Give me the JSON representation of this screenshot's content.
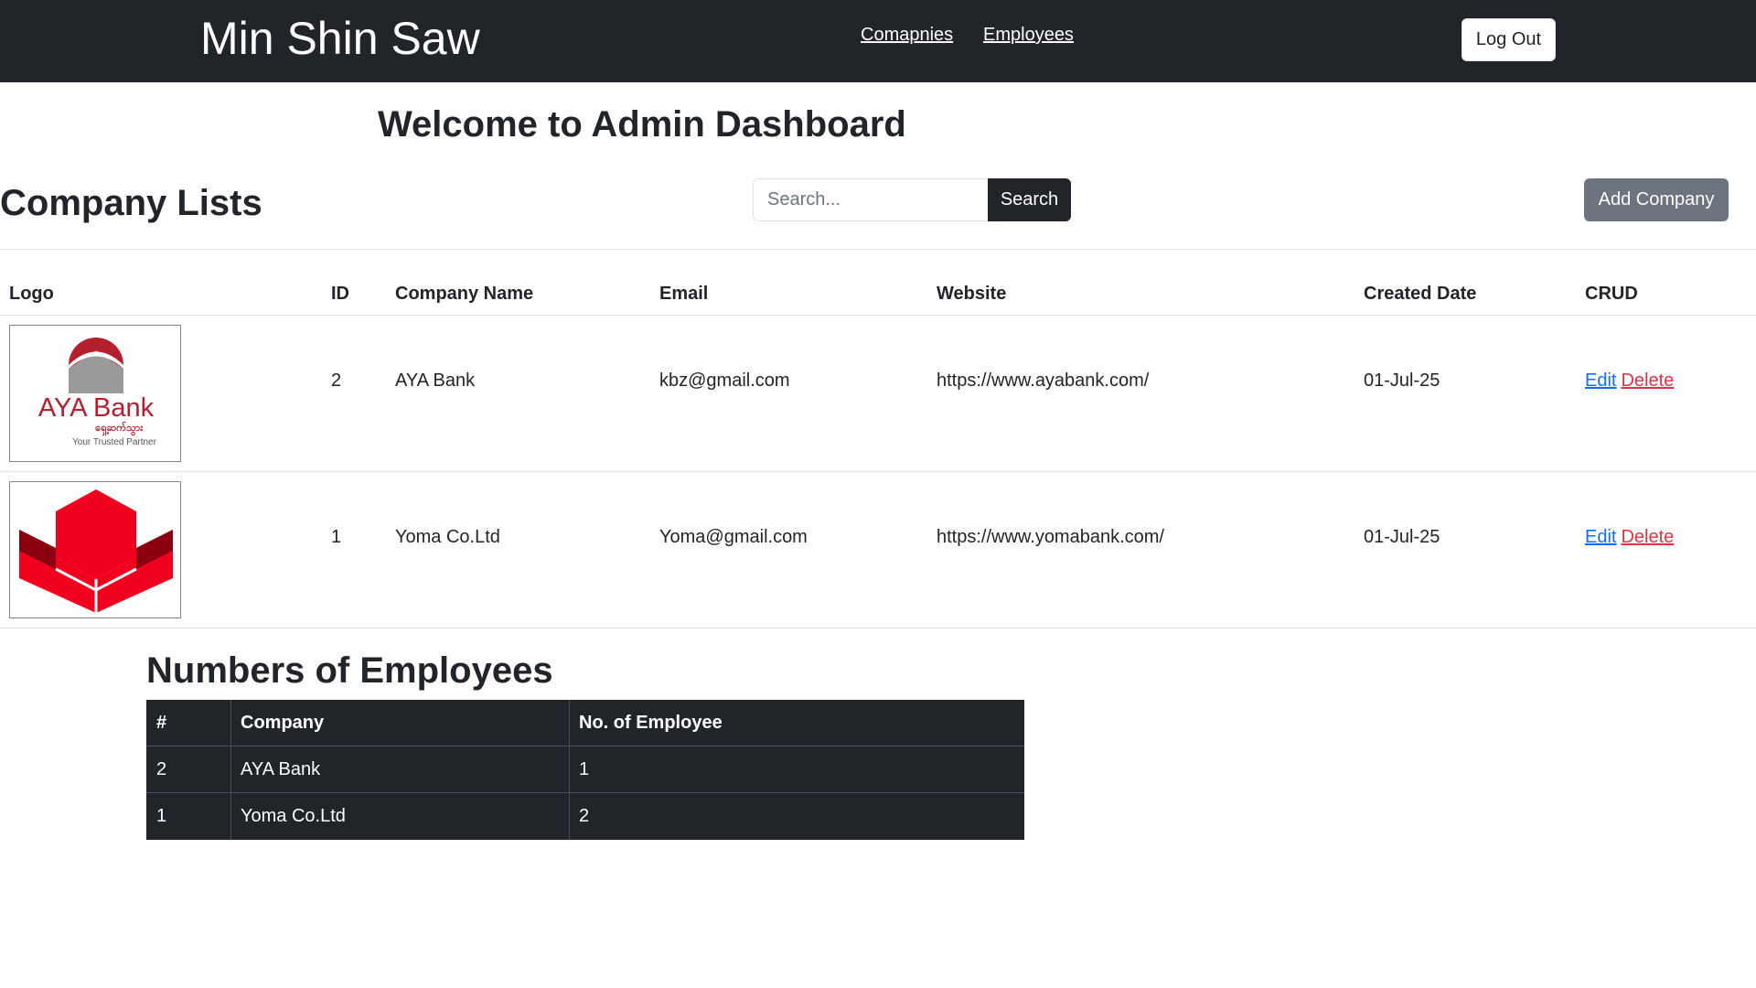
{
  "navbar": {
    "brand": "Min Shin Saw",
    "links": [
      "Comapnies",
      "Employees"
    ],
    "logout_label": "Log Out"
  },
  "welcome": "Welcome to Admin Dashboard",
  "companies": {
    "title": "Company Lists",
    "search_placeholder": "Search...",
    "search_label": "Search",
    "add_label": "Add Company",
    "columns": [
      "Logo",
      "ID",
      "Company Name",
      "Email",
      "Website",
      "Created Date",
      "CRUD"
    ],
    "rows": [
      {
        "logo": "aya-bank-logo",
        "logo_text": "AYA Bank",
        "logo_sub": "ရှေ့ဆက်သွား",
        "logo_tagline": "Your Trusted Partner",
        "id": "2",
        "name": "AYA Bank",
        "email": "kbz@gmail.com",
        "website": "https://www.ayabank.com/",
        "created": "01-Jul-25",
        "edit": "Edit",
        "delete": "Delete"
      },
      {
        "logo": "yoma-bank-logo",
        "id": "1",
        "name": "Yoma Co.Ltd",
        "email": "Yoma@gmail.com",
        "website": "https://www.yomabank.com/",
        "created": "01-Jul-25",
        "edit": "Edit",
        "delete": "Delete"
      }
    ]
  },
  "employees": {
    "title": "Numbers of Employees",
    "columns": [
      "#",
      "Company",
      "No. of Employee"
    ],
    "rows": [
      {
        "num": "2",
        "company": "AYA Bank",
        "count": "1"
      },
      {
        "num": "1",
        "company": "Yoma Co.Ltd",
        "count": "2"
      }
    ]
  },
  "colors": {
    "navbar": "#212529",
    "secondary_button": "#6c757d",
    "edit_link": "#0d6efd",
    "delete_link": "#dc3545",
    "aya_red": "#b5202e",
    "yoma_red": "#f0001e"
  }
}
